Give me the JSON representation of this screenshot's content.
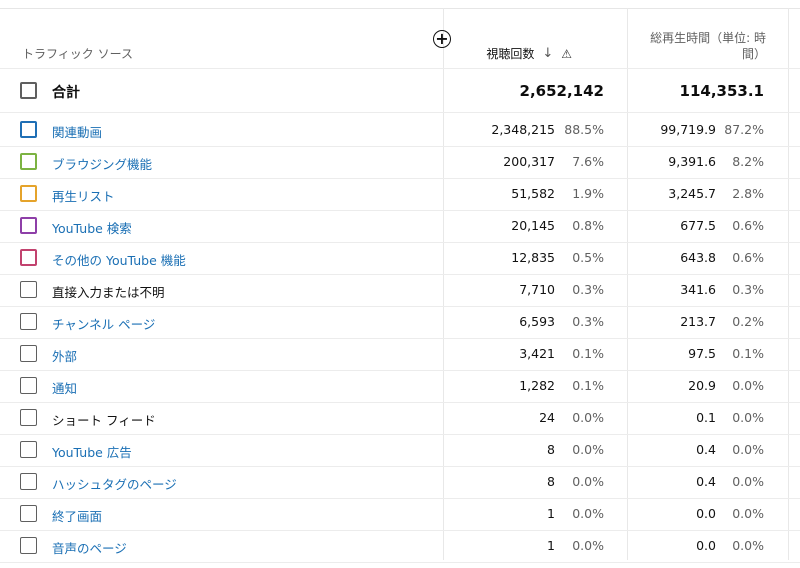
{
  "header": {
    "source_col": "トラフィック ソース",
    "views_col": "視聴回数",
    "watch_col": "総再生時間（単位: 時間）",
    "sort_icon": "arrow-down-icon",
    "warning_icon": "warning-icon",
    "add_icon": "plus-circle-icon"
  },
  "total": {
    "label": "合計",
    "views": "2,652,142",
    "watch": "114,353.1"
  },
  "rows": [
    {
      "label": "関連動画",
      "color": "#1f6fb5",
      "link": true,
      "views": "2,348,215",
      "views_pct": "88.5%",
      "watch": "99,719.9",
      "watch_pct": "87.2%"
    },
    {
      "label": "ブラウジング機能",
      "color": "#7cb342",
      "link": true,
      "views": "200,317",
      "views_pct": "7.6%",
      "watch": "9,391.6",
      "watch_pct": "8.2%"
    },
    {
      "label": "再生リスト",
      "color": "#e5a32b",
      "link": true,
      "views": "51,582",
      "views_pct": "1.9%",
      "watch": "3,245.7",
      "watch_pct": "2.8%"
    },
    {
      "label": "YouTube 検索",
      "color": "#8e3fa8",
      "link": true,
      "views": "20,145",
      "views_pct": "0.8%",
      "watch": "677.5",
      "watch_pct": "0.6%"
    },
    {
      "label": "その他の YouTube 機能",
      "color": "#c2426e",
      "link": true,
      "views": "12,835",
      "views_pct": "0.5%",
      "watch": "643.8",
      "watch_pct": "0.6%"
    },
    {
      "label": "直接入力または不明",
      "color": "#5f5f5f",
      "link": false,
      "views": "7,710",
      "views_pct": "0.3%",
      "watch": "341.6",
      "watch_pct": "0.3%"
    },
    {
      "label": "チャンネル ページ",
      "color": "#5f5f5f",
      "link": true,
      "views": "6,593",
      "views_pct": "0.3%",
      "watch": "213.7",
      "watch_pct": "0.2%"
    },
    {
      "label": "外部",
      "color": "#5f5f5f",
      "link": true,
      "views": "3,421",
      "views_pct": "0.1%",
      "watch": "97.5",
      "watch_pct": "0.1%"
    },
    {
      "label": "通知",
      "color": "#5f5f5f",
      "link": true,
      "views": "1,282",
      "views_pct": "0.1%",
      "watch": "20.9",
      "watch_pct": "0.0%"
    },
    {
      "label": "ショート フィード",
      "color": "#5f5f5f",
      "link": false,
      "views": "24",
      "views_pct": "0.0%",
      "watch": "0.1",
      "watch_pct": "0.0%"
    },
    {
      "label": "YouTube 広告",
      "color": "#5f5f5f",
      "link": true,
      "views": "8",
      "views_pct": "0.0%",
      "watch": "0.4",
      "watch_pct": "0.0%"
    },
    {
      "label": "ハッシュタグのページ",
      "color": "#5f5f5f",
      "link": true,
      "views": "8",
      "views_pct": "0.0%",
      "watch": "0.4",
      "watch_pct": "0.0%"
    },
    {
      "label": "終了画面",
      "color": "#5f5f5f",
      "link": true,
      "views": "1",
      "views_pct": "0.0%",
      "watch": "0.0",
      "watch_pct": "0.0%"
    },
    {
      "label": "音声のページ",
      "color": "#5f5f5f",
      "link": true,
      "views": "1",
      "views_pct": "0.0%",
      "watch": "0.0",
      "watch_pct": "0.0%"
    }
  ]
}
